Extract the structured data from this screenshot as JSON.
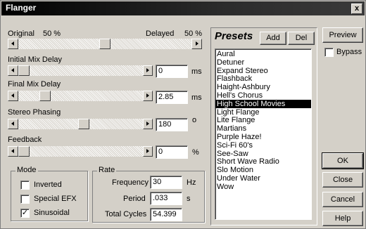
{
  "window": {
    "title": "Flanger",
    "close_glyph": "x"
  },
  "mix": {
    "original_label": "Original",
    "original_value": "50 %",
    "delayed_label": "Delayed",
    "delayed_value": "50 %",
    "position": 0.5
  },
  "initial_mix_delay": {
    "label": "Initial Mix Delay",
    "value": "0",
    "unit": "ms",
    "position": 0.0
  },
  "final_mix_delay": {
    "label": "Final Mix Delay",
    "value": "2.85",
    "unit": "ms",
    "position": 0.18
  },
  "stereo_phasing": {
    "label": "Stereo Phasing",
    "value": "180",
    "unit": "o",
    "position": 0.5
  },
  "feedback": {
    "label": "Feedback",
    "value": "0",
    "unit": "%",
    "position": 0.0
  },
  "mode": {
    "label": "Mode",
    "inverted": {
      "label": "Inverted",
      "checked": false
    },
    "special_efx": {
      "label": "Special EFX",
      "checked": false
    },
    "sinusoidal": {
      "label": "Sinusoidal",
      "checked": true,
      "check_glyph": "✓"
    }
  },
  "rate": {
    "label": "Rate",
    "frequency_label": "Frequency",
    "frequency_value": "30",
    "frequency_unit": "Hz",
    "period_label": "Period",
    "period_value": ".033",
    "period_unit": "s",
    "total_cycles_label": "Total Cycles",
    "total_cycles_value": "54.399"
  },
  "presets": {
    "title": "Presets",
    "add_label": "Add",
    "del_label": "Del",
    "selected_index": 6,
    "items": [
      "Aural",
      "Detuner",
      "Expand Stereo",
      "Flashback",
      "Haight-Ashbury",
      "Hell's Chorus",
      "High School Movies",
      "Light Flange",
      "Lite Flange",
      "Martians",
      "Purple Haze!",
      "Sci-Fi 60's",
      "See-Saw",
      "Short Wave Radio",
      "Slo Motion",
      "Under Water",
      "Wow"
    ]
  },
  "side": {
    "preview_label": "Preview",
    "bypass_label": "Bypass",
    "bypass_checked": false,
    "ok_label": "OK",
    "close_label": "Close",
    "cancel_label": "Cancel",
    "help_label": "Help"
  }
}
